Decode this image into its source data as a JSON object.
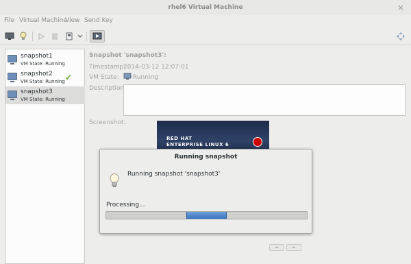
{
  "window": {
    "title": "rhel6 Virtual Machine",
    "close_glyph": "×"
  },
  "menubar": {
    "items": [
      "File",
      "Virtual Machine",
      "View",
      "Send Key"
    ]
  },
  "toolbar": {
    "icons": [
      "console-monitor-icon",
      "details-lightbulb-icon",
      "run-icon",
      "pause-icon",
      "shutdown-icon",
      "dropdown-chevron-icon",
      "snapshots-icon",
      "fullscreen-icon"
    ]
  },
  "snapshots": [
    {
      "name": "snapshot1",
      "state": "VM State: Running",
      "current": false,
      "selected": false
    },
    {
      "name": "snapshot2",
      "state": "VM State: Running",
      "current": true,
      "selected": false
    },
    {
      "name": "snapshot3",
      "state": "VM State: Running",
      "current": false,
      "selected": true
    }
  ],
  "details": {
    "heading": "Snapshot 'snapshot3':",
    "timestamp_label": "Timestamp:",
    "timestamp_value": "2014-03-12 12:07:01",
    "vmstate_label": "VM State:",
    "vmstate_value": "Running",
    "description_label": "Description:",
    "description_value": "",
    "screenshot_label": "Screenshot:",
    "screenshot_line1": "RED HAT",
    "screenshot_line2": "ENTERPRISE LINUX 6"
  },
  "dialog": {
    "title": "Running snapshot",
    "message": "Running snapshot 'snapshot3'",
    "status": "Processing...",
    "progress_note": "indeterminate (pulse)"
  },
  "colors": {
    "accent": "#3a74c0",
    "check": "#6bb93b",
    "selection": "#dcdcdb"
  }
}
